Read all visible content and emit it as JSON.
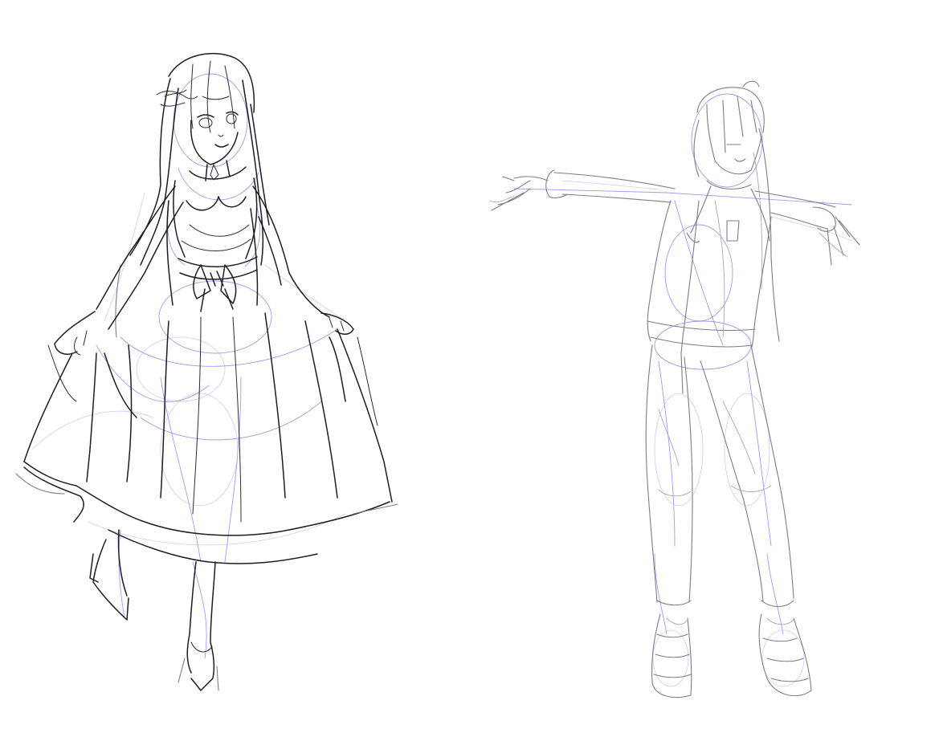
{
  "canvas": {
    "background": "#ffffff",
    "line_color": "#1c1c24",
    "construction_color": "#7b7ee6",
    "sketch_color": "#7d7d86"
  },
  "figures": [
    {
      "id": "left",
      "description_icon": "dress-figure-icon"
    },
    {
      "id": "right",
      "description_icon": "t-pose-figure-icon"
    }
  ]
}
